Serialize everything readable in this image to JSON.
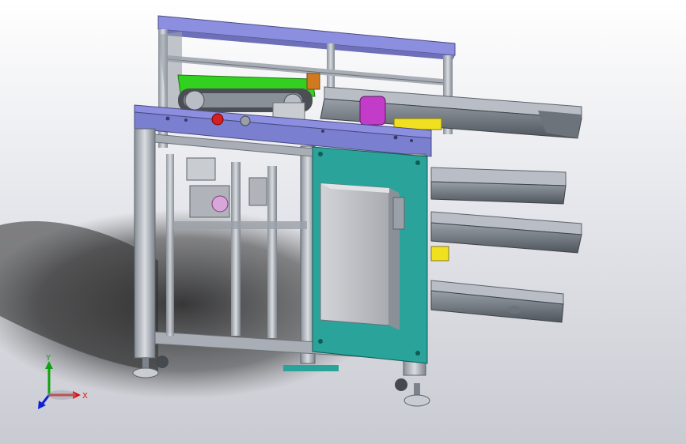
{
  "viewport": {
    "background_top": "#ffffff",
    "background_bottom": "#c9cbd2"
  },
  "colors": {
    "frame_top_plate": "#8c8fe0",
    "aluminum_profile": "#b9bec6",
    "aluminum_dark": "#7d838c",
    "conveyor_belt": "#33d11f",
    "mounting_plate": "#2aa39a",
    "electrical_box": "#c4c6ca",
    "rail_dark": "#5d636b",
    "accent_yellow": "#f0e020",
    "accent_magenta": "#c23bc9",
    "stop_button": "#d42020",
    "axis_x": "#e01010",
    "axis_y": "#10a010",
    "axis_z": "#1020d0"
  },
  "triad": {
    "x_label": "X",
    "y_label": "Y"
  }
}
